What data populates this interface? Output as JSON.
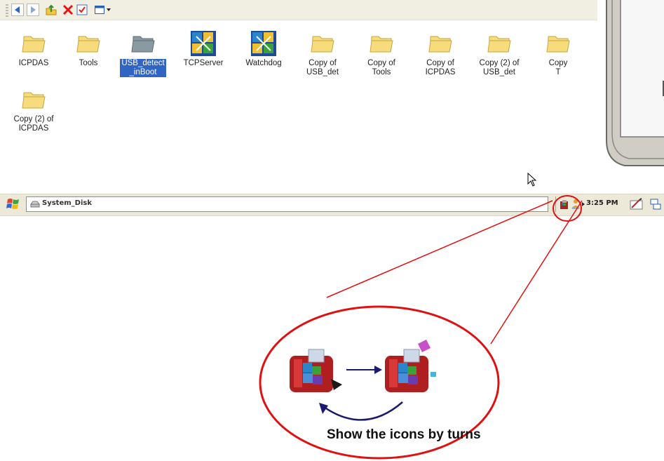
{
  "toolbar": {
    "buttons": [
      "back-icon",
      "forward-icon",
      "up-folder-icon",
      "delete-icon",
      "properties-icon",
      "views-icon"
    ]
  },
  "desktop": {
    "items": [
      {
        "label": "ICPDAS",
        "icon": "folder-icon",
        "selected": false
      },
      {
        "label": "Tools",
        "icon": "folder-icon",
        "selected": false
      },
      {
        "label": "USB_detect\n_inBoot",
        "icon": "folder-icon",
        "selected": true
      },
      {
        "label": "TCPServer",
        "icon": "app-cubes-icon",
        "selected": false
      },
      {
        "label": "Watchdog",
        "icon": "app-cubes-icon",
        "selected": false
      },
      {
        "label": "Copy of\nUSB_det",
        "icon": "folder-icon",
        "selected": false
      },
      {
        "label": "Copy of\nTools",
        "icon": "folder-icon",
        "selected": false
      },
      {
        "label": "Copy of\nICPDAS",
        "icon": "folder-icon",
        "selected": false
      },
      {
        "label": "Copy (2) of\nUSB_det",
        "icon": "folder-icon",
        "selected": false
      },
      {
        "label": "Copy\nT",
        "icon": "folder-icon",
        "selected": false
      },
      {
        "label": "Copy (2) of\nICPDAS",
        "icon": "folder-icon",
        "selected": false
      }
    ]
  },
  "taskbar": {
    "address": "System_Disk",
    "clock": "3:25 PM"
  },
  "callout": {
    "caption": "Show the icons by turns"
  },
  "colors": {
    "folder": "#f6dc7c",
    "selection": "#3165c5",
    "callout_red": "#e01010",
    "arrow_navy": "#1a1a6e"
  }
}
